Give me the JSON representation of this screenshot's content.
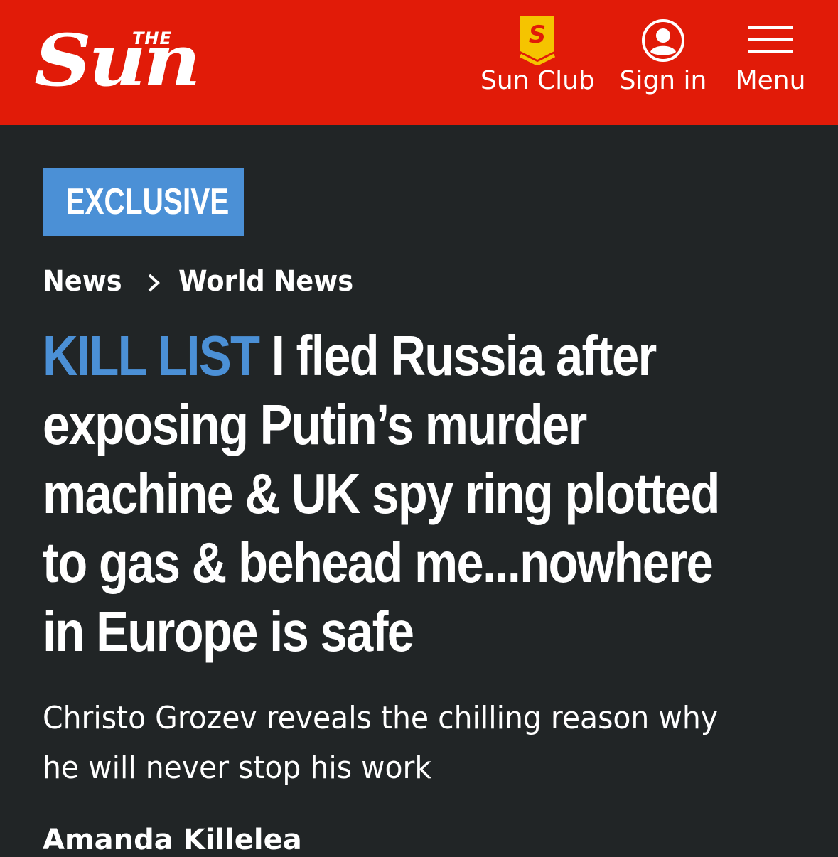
{
  "header": {
    "logo": {
      "the": "THE",
      "sun": "Sun"
    },
    "nav": {
      "sun_club": {
        "label": "Sun Club",
        "icon": "sun-club-badge-icon",
        "badge_letter": "S"
      },
      "sign_in": {
        "label": "Sign in",
        "icon": "user-icon"
      },
      "menu": {
        "label": "Menu",
        "icon": "hamburger-menu-icon"
      }
    },
    "colors": {
      "bar": "#e11b08",
      "badge": "#f5c400"
    }
  },
  "article": {
    "tag": "EXCLUSIVE",
    "breadcrumb": [
      "News",
      "World News"
    ],
    "headline": {
      "kicker": "KILL LIST",
      "lines": [
        "I fled Russia after",
        "exposing Putin’s murder",
        "machine & UK spy ring plotted",
        "to gas & behead me...nowhere",
        "in Europe is safe"
      ]
    },
    "standfirst": [
      "Christo Grozev reveals the chilling reason why",
      "he will never stop his work"
    ],
    "author": "Amanda Killelea",
    "colors": {
      "background": "#212526",
      "accent": "#4b90d6"
    }
  }
}
